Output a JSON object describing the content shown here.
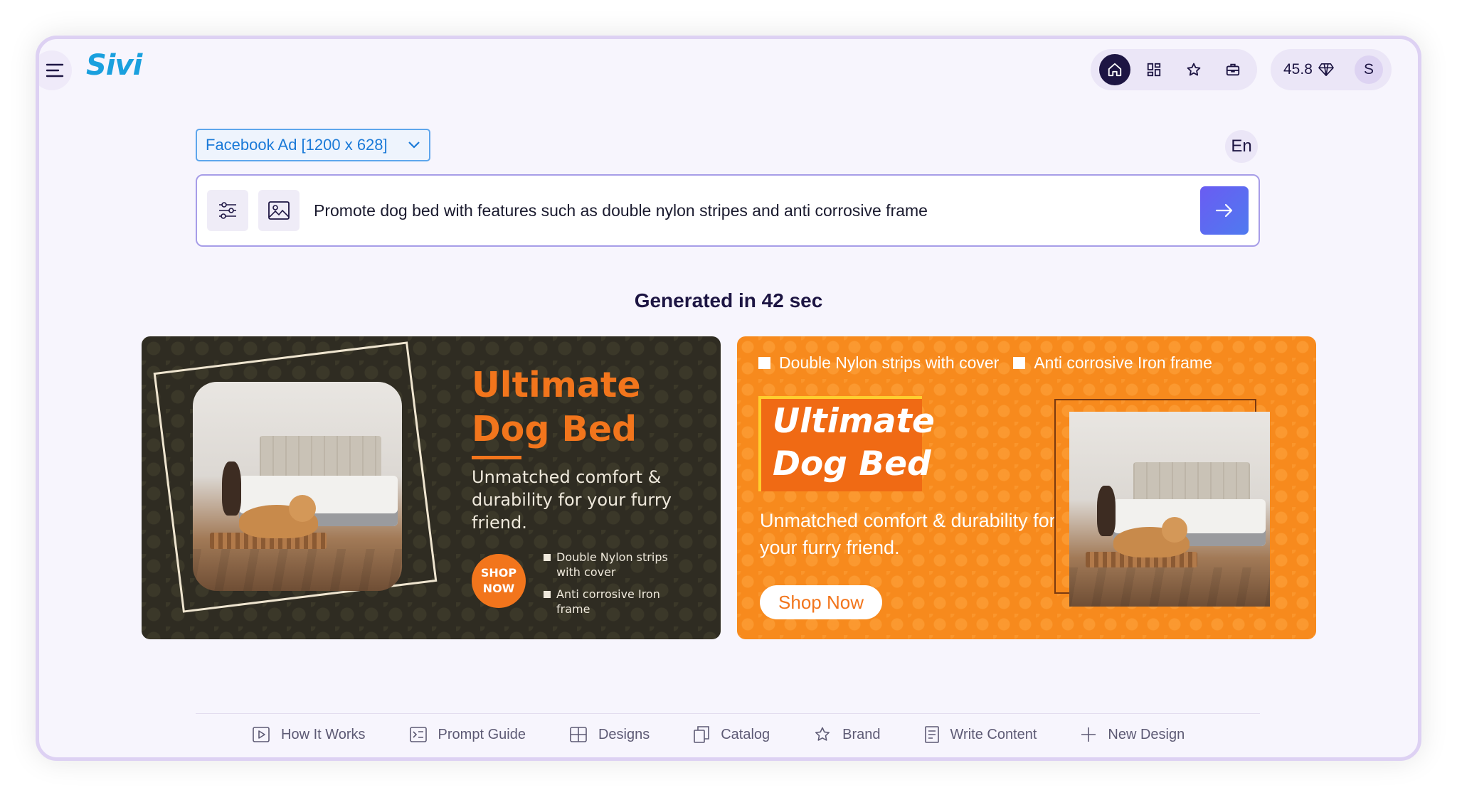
{
  "app": {
    "logo": "Sivi"
  },
  "header": {
    "credits": "45.8",
    "avatar_initial": "S"
  },
  "format_select": {
    "value": "Facebook Ad [1200 x 628]"
  },
  "language": {
    "label": "En"
  },
  "prompt": {
    "text": "Promote dog bed with features such as double nylon stripes and anti corrosive frame"
  },
  "result": {
    "title": "Generated in 42 sec"
  },
  "ads": [
    {
      "title_line1": "Ultimate",
      "title_line2": "Dog Bed",
      "subtitle": "Unmatched comfort & durability for your furry friend.",
      "cta": "SHOP NOW",
      "bullets": [
        "Double Nylon strips with cover",
        "Anti corrosive Iron frame"
      ]
    },
    {
      "features": [
        "Double Nylon strips with cover",
        "Anti corrosive Iron frame"
      ],
      "title_line1": "Ultimate",
      "title_line2": "Dog Bed",
      "subtitle": "Unmatched comfort & durability for your furry friend.",
      "cta": "Shop Now"
    }
  ],
  "bottom_nav": [
    {
      "label": "How It Works",
      "icon": "play-icon"
    },
    {
      "label": "Prompt Guide",
      "icon": "terminal-icon"
    },
    {
      "label": "Designs",
      "icon": "grid-icon"
    },
    {
      "label": "Catalog",
      "icon": "copy-icon"
    },
    {
      "label": "Brand",
      "icon": "star-icon"
    },
    {
      "label": "Write Content",
      "icon": "document-icon"
    },
    {
      "label": "New Design",
      "icon": "plus-icon"
    }
  ],
  "colors": {
    "accent": "#1d1543",
    "link_blue": "#1b7ad8",
    "ad_orange": "#f2751c",
    "ad_dark_bg": "#2f2c22"
  }
}
